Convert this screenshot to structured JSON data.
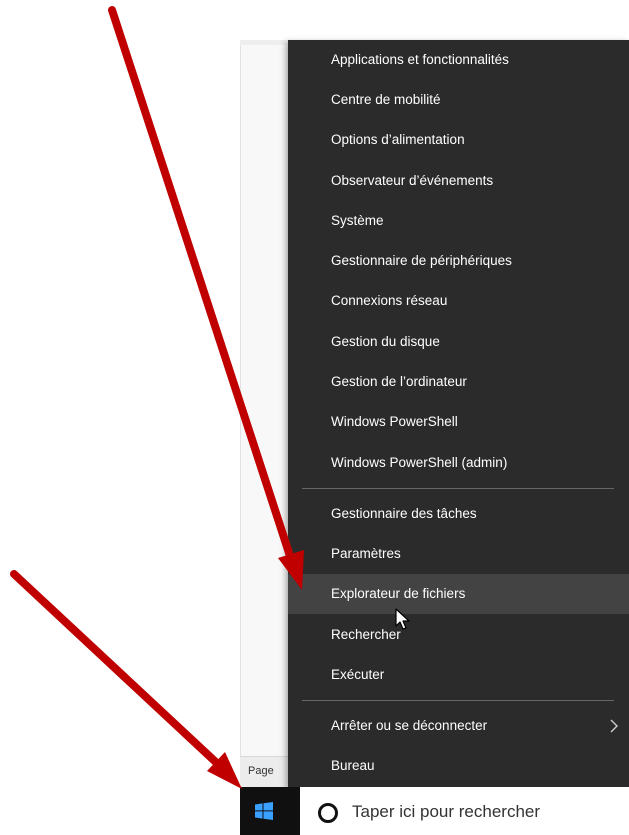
{
  "context_menu": {
    "items": [
      {
        "label": "Applications et fonctionnalités"
      },
      {
        "label": "Centre de mobilité"
      },
      {
        "label": "Options d’alimentation"
      },
      {
        "label": "Observateur d’événements"
      },
      {
        "label": "Système"
      },
      {
        "label": "Gestionnaire de périphériques"
      },
      {
        "label": "Connexions réseau"
      },
      {
        "label": "Gestion du disque"
      },
      {
        "label": "Gestion de l’ordinateur"
      },
      {
        "label": "Windows PowerShell"
      },
      {
        "label": "Windows PowerShell (admin)"
      },
      {
        "label": "Gestionnaire des tâches"
      },
      {
        "label": "Paramètres"
      },
      {
        "label": "Explorateur de fichiers",
        "highlighted": true
      },
      {
        "label": "Rechercher"
      },
      {
        "label": "Exécuter"
      },
      {
        "label": "Arrêter ou se déconnecter",
        "submenu_icon": "chevron-right-icon"
      },
      {
        "label": "Bureau"
      }
    ]
  },
  "status_bar": {
    "text": "Page"
  },
  "taskbar": {
    "start_icon": "windows-logo-icon",
    "search_icon": "cortana-circle-icon",
    "search_placeholder": "Taper ici pour rechercher"
  },
  "annotations": {
    "arrow_color": "#c00000",
    "arrow_icon": "red-arrow-icon"
  },
  "colors": {
    "menu_background": "#2b2b2b",
    "menu_highlight": "#434343",
    "menu_text": "#ffffff",
    "taskbar_background": "#101010",
    "start_logo": "#3aa0ff"
  }
}
